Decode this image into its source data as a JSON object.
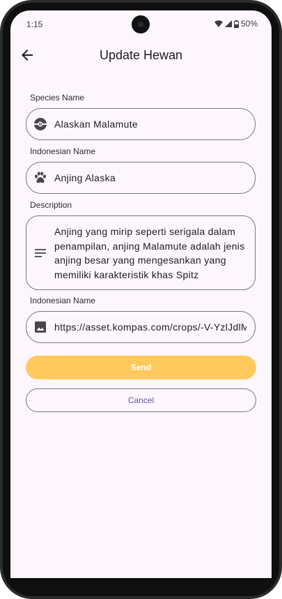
{
  "status_bar": {
    "time": "1:15",
    "battery": "50%"
  },
  "header": {
    "title": "Update Hewan"
  },
  "form": {
    "species_label": "Species Name",
    "species_value": "Alaskan Malamute",
    "indonesian_label": "Indonesian Name",
    "indonesian_value": "Anjing Alaska",
    "description_label": "Description",
    "description_value": "Anjing yang mirip seperti serigala dalam penampilan, anjing Malamute adalah jenis anjing besar yang mengesankan yang memiliki karakteristik khas Spitz",
    "image_label": "Indonesian Name",
    "image_value": "https://asset.kompas.com/crops/-V-YzlJdlM"
  },
  "actions": {
    "send_label": "Send",
    "cancel_label": "Cancel"
  },
  "colors": {
    "send_bg": "#ffc95e",
    "cancel_text": "#6750a4",
    "background": "#fdf7fd"
  }
}
